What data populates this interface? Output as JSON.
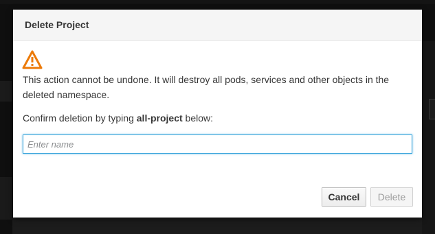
{
  "dialog": {
    "title": "Delete Project",
    "warning_icon": "warning-triangle-icon",
    "message": "This action cannot be undone. It will destroy all pods, services and other objects in the deleted namespace.",
    "confirm_prefix": "Confirm deletion by typing ",
    "project_name": "all-project",
    "confirm_suffix": " below:",
    "input": {
      "value": "",
      "placeholder": "Enter name"
    },
    "cancel_label": "Cancel",
    "delete_label": "Delete"
  },
  "colors": {
    "warning": "#ec7a08",
    "focus_border": "#39a5dc",
    "backdrop": "#0f0f0f"
  }
}
